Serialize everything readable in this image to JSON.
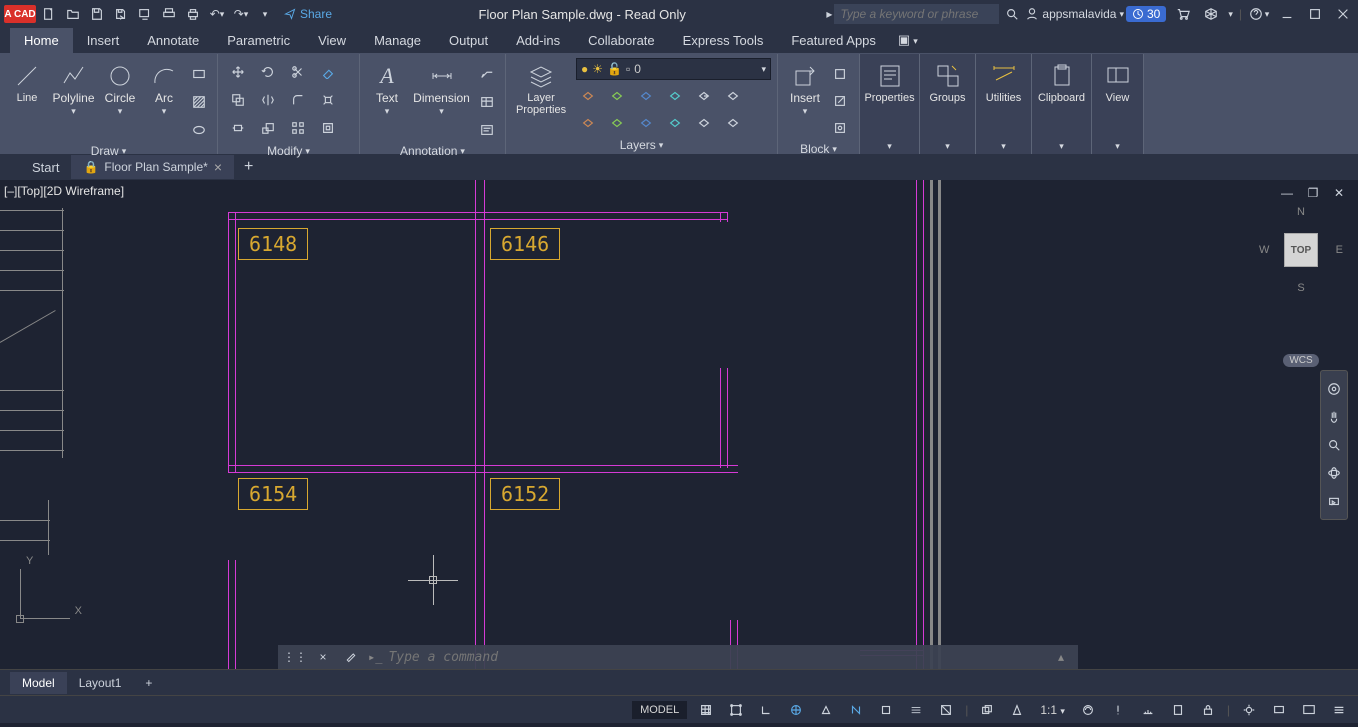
{
  "appIcon": "A CAD",
  "shareLabel": "Share",
  "windowTitle": "Floor Plan Sample.dwg - Read Only",
  "searchPlaceholder": "Type a keyword or phrase",
  "username": "appsmalavida",
  "trialBadge": "30",
  "ribbonTabs": [
    "Home",
    "Insert",
    "Annotate",
    "Parametric",
    "View",
    "Manage",
    "Output",
    "Add-ins",
    "Collaborate",
    "Express Tools",
    "Featured Apps"
  ],
  "draw": {
    "line": "Line",
    "polyline": "Polyline",
    "circle": "Circle",
    "arc": "Arc",
    "label": "Draw"
  },
  "modify": {
    "label": "Modify"
  },
  "annotation": {
    "text": "Text",
    "dimension": "Dimension",
    "label": "Annotation"
  },
  "layers": {
    "properties": "Layer\nProperties",
    "current": "0",
    "label": "Layers"
  },
  "block": {
    "insert": "Insert",
    "label": "Block"
  },
  "groups": {
    "properties": "Properties",
    "groups": "Groups",
    "utilities": "Utilities",
    "clipboard": "Clipboard",
    "view": "View"
  },
  "fileTabs": {
    "start": "Start",
    "active": "Floor Plan Sample*"
  },
  "viewLabel": "[–][Top][2D Wireframe]",
  "rooms": {
    "r1": "6148",
    "r2": "6146",
    "r3": "6154",
    "r4": "6152"
  },
  "viewcube": {
    "top": "TOP",
    "n": "N",
    "s": "S",
    "e": "E",
    "w": "W",
    "wcs": "WCS"
  },
  "axis": {
    "x": "X",
    "y": "Y"
  },
  "cmdPlaceholder": "Type a command",
  "layoutTabs": {
    "model": "Model",
    "layout1": "Layout1"
  },
  "status": {
    "model": "MODEL",
    "scale": "1:1"
  }
}
